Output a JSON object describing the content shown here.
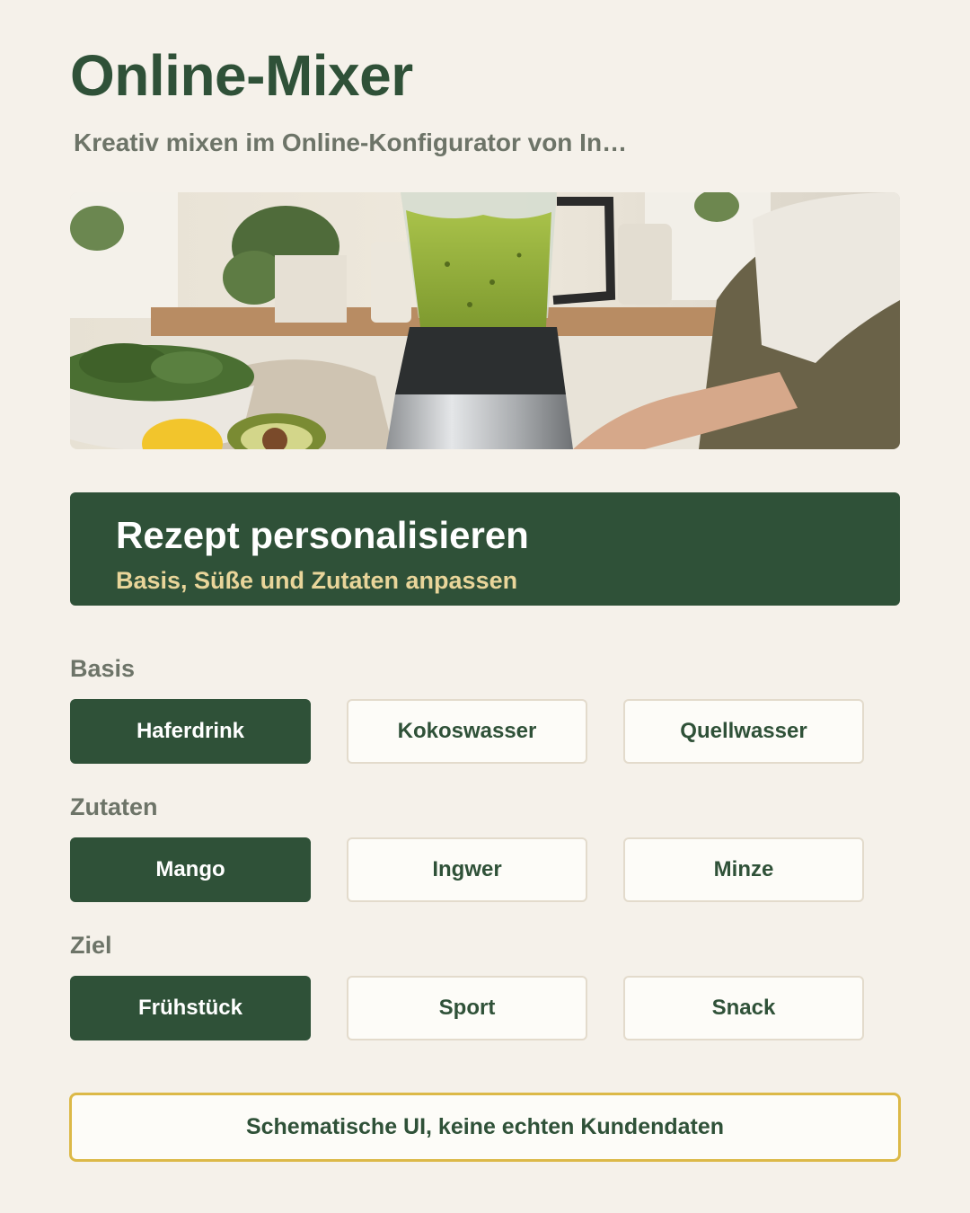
{
  "header": {
    "title": "Online-Mixer",
    "subtitle": "Kreativ mixen im Online-Konfigurator von In…"
  },
  "hero": {
    "icon": "blender-kitchen-photo"
  },
  "banner": {
    "title": "Rezept personalisieren",
    "subtitle": "Basis, Süße und Zutaten anpassen"
  },
  "groups": [
    {
      "label": "Basis",
      "options": [
        {
          "label": "Haferdrink",
          "selected": true
        },
        {
          "label": "Kokoswasser",
          "selected": false
        },
        {
          "label": "Quellwasser",
          "selected": false
        }
      ]
    },
    {
      "label": "Zutaten",
      "options": [
        {
          "label": "Mango",
          "selected": true
        },
        {
          "label": "Ingwer",
          "selected": false
        },
        {
          "label": "Minze",
          "selected": false
        }
      ]
    },
    {
      "label": "Ziel",
      "options": [
        {
          "label": "Frühstück",
          "selected": true
        },
        {
          "label": "Sport",
          "selected": false
        },
        {
          "label": "Snack",
          "selected": false
        }
      ]
    }
  ],
  "footer": {
    "note": "Schematische UI, keine echten Kundendaten"
  },
  "colors": {
    "accent": "#2f5138",
    "background": "#f5f1ea",
    "highlight": "#e9d59a",
    "note_border": "#dcb948"
  }
}
